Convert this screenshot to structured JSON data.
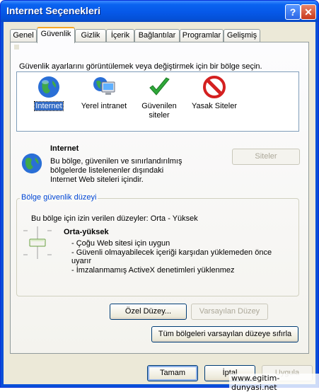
{
  "window": {
    "title": "Internet Seçenekleri",
    "help_glyph": "?",
    "close_glyph": "✕"
  },
  "tabs": [
    {
      "label": "Genel",
      "active": false
    },
    {
      "label": "Güvenlik",
      "active": true
    },
    {
      "label": "Gizlik",
      "active": false
    },
    {
      "label": "İçerik",
      "active": false
    },
    {
      "label": "Bağlantılar",
      "active": false
    },
    {
      "label": "Programlar",
      "active": false
    },
    {
      "label": "Gelişmiş",
      "active": false
    }
  ],
  "security": {
    "instruction": "Güvenlik ayarlarını görüntülemek veya değiştirmek için bir bölge seçin.",
    "zones": [
      {
        "label": "Internet",
        "icon": "globe-icon",
        "selected": true
      },
      {
        "label": "Yerel intranet",
        "icon": "intranet-icon",
        "selected": false
      },
      {
        "label": "Güvenilen siteler",
        "icon": "checkmark-icon",
        "selected": false
      },
      {
        "label": "Yasak Siteler",
        "icon": "no-entry-icon",
        "selected": false
      }
    ],
    "zone_title": "Internet",
    "zone_desc_1": "Bu bölge, güvenilen ve sınırlandırılmış",
    "zone_desc_2": "bölgelerde listelenenler dışındaki",
    "zone_desc_3": "Internet Web siteleri içindir.",
    "sites_button": "Siteler"
  },
  "level": {
    "group_label": "Bölge güvenlik düzeyi",
    "allowed_text": "Bu bölge için izin verilen düzeyler: Orta - Yüksek",
    "level_name": "Orta-yüksek",
    "bullet_1": "- Çoğu Web sitesi için uygun",
    "bullet_2a": "- Güvenli olmayabilecek içeriği karşıdan yüklemeden önce",
    "bullet_2b": "uyarır",
    "bullet_3": "- İmzalanmamış ActiveX denetimleri yüklenmez",
    "custom_button": "Özel Düzey...",
    "default_button": "Varsayılan Düzey",
    "reset_all_button": "Tüm bölgeleri varsayılan düzeye sıfırla"
  },
  "footer": {
    "ok": "Tamam",
    "cancel": "İptal",
    "apply": "Uygula"
  },
  "watermark": "www.egitim-dunyasi.net",
  "colors": {
    "title_blue": "#0a63f0",
    "selection": "#316ac5",
    "group_label": "#0046d5",
    "dialog_bg": "#ece9d8"
  }
}
